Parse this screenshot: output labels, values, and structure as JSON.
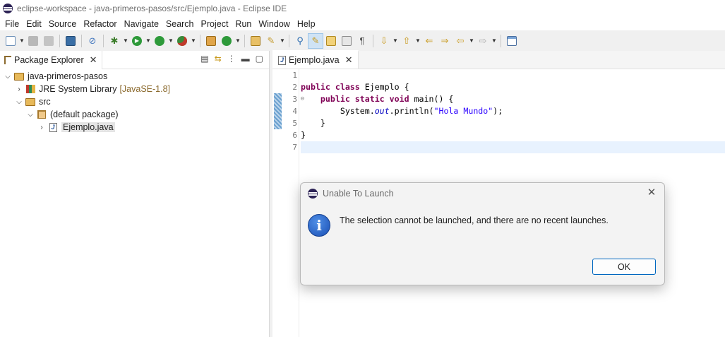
{
  "window": {
    "title": "eclipse-workspace - java-primeros-pasos/src/Ejemplo.java - Eclipse IDE"
  },
  "menu": [
    "File",
    "Edit",
    "Source",
    "Refactor",
    "Navigate",
    "Search",
    "Project",
    "Run",
    "Window",
    "Help"
  ],
  "package_explorer": {
    "tab_label": "Package Explorer",
    "tree": {
      "project": "java-primeros-pasos",
      "jre_label": "JRE System Library",
      "jre_version": "[JavaSE-1.8]",
      "src": "src",
      "package": "(default package)",
      "file": "Ejemplo.java"
    }
  },
  "editor": {
    "tab_label": "Ejemplo.java",
    "line_numbers": [
      "1",
      "2",
      "3",
      "4",
      "5",
      "6",
      "7"
    ]
  },
  "dialog": {
    "title": "Unable To Launch",
    "message": "The selection cannot be launched, and there are no recent launches.",
    "ok_label": "OK"
  }
}
